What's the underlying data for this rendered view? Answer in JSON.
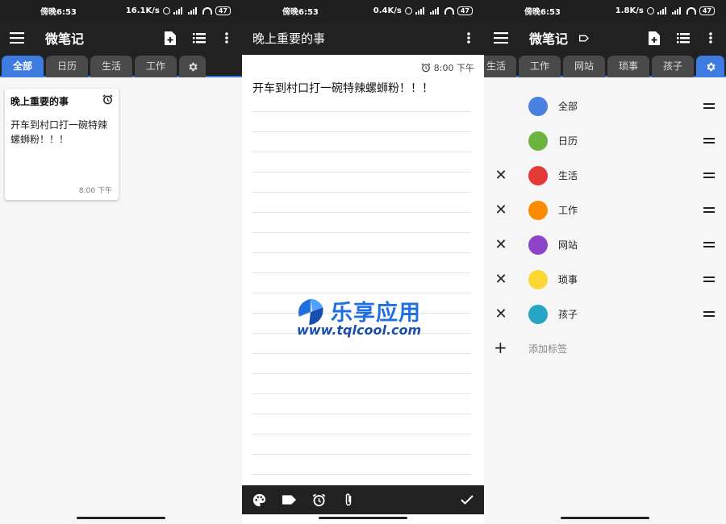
{
  "status": [
    {
      "time": "傍晚6:53",
      "speed": "16.1K/s",
      "battery": "47"
    },
    {
      "time": "傍晚6:53",
      "speed": "0.4K/s",
      "battery": "47"
    },
    {
      "time": "傍晚6:53",
      "speed": "1.8K/s",
      "battery": "47"
    }
  ],
  "app_title": "微笔记",
  "tabs_main": [
    "全部",
    "日历",
    "生活",
    "工作"
  ],
  "tabs_scrolled": [
    "生活",
    "工作",
    "网站",
    "琐事",
    "孩子"
  ],
  "note": {
    "title": "晚上重要的事",
    "body": "开车到村口打一碗特辣螺蛳粉！！！",
    "time": "8:00 下午"
  },
  "editor": {
    "title": "晚上重要的事",
    "time": "8:00 下午",
    "text": "开车到村口打一碗特辣螺蛳粉！！！"
  },
  "watermark": {
    "cn": "乐享应用",
    "en": "www.tqlcool.com"
  },
  "tags": [
    {
      "name": "全部",
      "color": "#4a80e0",
      "removable": false
    },
    {
      "name": "日历",
      "color": "#6db33f",
      "removable": false
    },
    {
      "name": "生活",
      "color": "#e53935",
      "removable": true
    },
    {
      "name": "工作",
      "color": "#fb8c00",
      "removable": true
    },
    {
      "name": "网站",
      "color": "#8e44c9",
      "removable": true
    },
    {
      "name": "琐事",
      "color": "#fdd835",
      "removable": true
    },
    {
      "name": "孩子",
      "color": "#26a6c4",
      "removable": true
    }
  ],
  "add_tag_label": "添加标签",
  "colors": {
    "accent": "#3d7be0",
    "bar": "#212121",
    "tab_inactive": "#4a4a4a"
  }
}
